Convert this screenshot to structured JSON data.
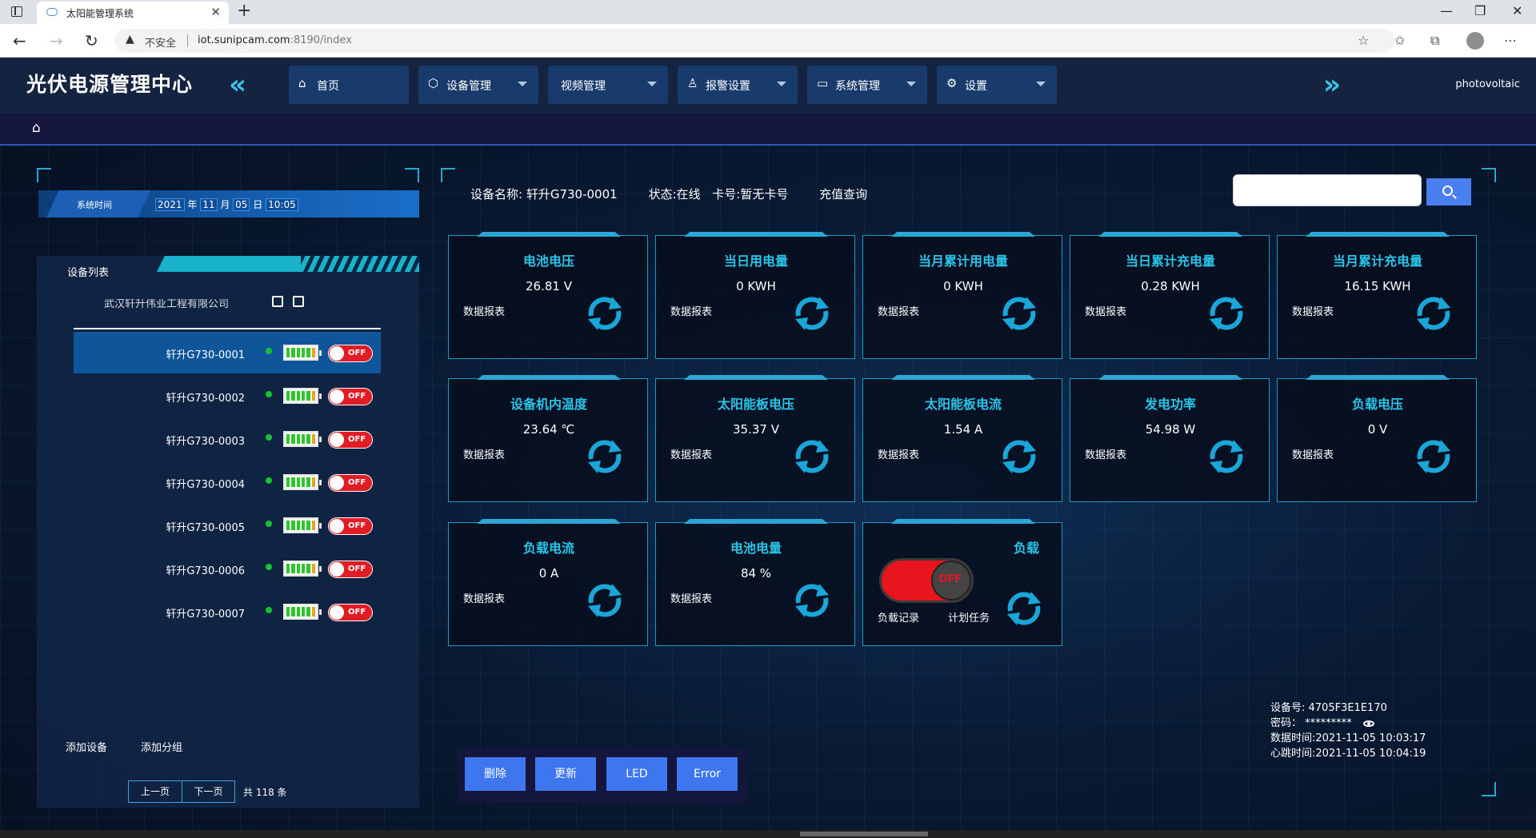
{
  "browser": {
    "tab_title": "太阳能管理系统",
    "tab_close": "✕",
    "new_tab": "+",
    "insecure_label": "不安全",
    "url_host": "iot.sunipcam.com",
    "url_path": ":8190/index"
  },
  "header": {
    "logo": "光伏电源管理中心",
    "collapse_arrow": "«",
    "expand_arrow": "»",
    "user": "photovoltaic",
    "nav": [
      {
        "label": "首页",
        "icon": "home-icon",
        "glyph": "⌂"
      },
      {
        "label": "设备管理",
        "icon": "cube-icon",
        "glyph": "⬡"
      },
      {
        "label": "视频管理",
        "icon": "",
        "glyph": ""
      },
      {
        "label": "报警设置",
        "icon": "user-icon",
        "glyph": "♙"
      },
      {
        "label": "系统管理",
        "icon": "monitor-icon",
        "glyph": "▭"
      },
      {
        "label": "设置",
        "icon": "gear-icon",
        "glyph": "⚙"
      }
    ]
  },
  "time": {
    "label": "系统时间",
    "year": "2021",
    "year_unit": "年",
    "month": "11",
    "month_unit": "月",
    "day": "05",
    "day_unit": "日",
    "clock": "10:05"
  },
  "device_list": {
    "title": "设备列表",
    "company": "武汉轩升伟业工程有限公司",
    "devices": [
      {
        "name": "轩升G730-0001",
        "switch": "OFF"
      },
      {
        "name": "轩升G730-0002",
        "switch": "OFF"
      },
      {
        "name": "轩升G730-0003",
        "switch": "OFF"
      },
      {
        "name": "轩升G730-0004",
        "switch": "OFF"
      },
      {
        "name": "轩升G730-0005",
        "switch": "OFF"
      },
      {
        "name": "轩升G730-0006",
        "switch": "OFF"
      },
      {
        "name": "轩升G730-0007",
        "switch": "OFF"
      }
    ],
    "add_device": "添加设备",
    "add_group": "添加分组",
    "prev": "上一页",
    "next": "下一页",
    "total": "共 118 条"
  },
  "info": {
    "device_name": "设备名称: 轩升G730-0001",
    "status": "状态:在线",
    "card": "卡号:暂无卡号",
    "recharge": "充值查询"
  },
  "cards": [
    {
      "title": "电池电压",
      "value": "26.81 V",
      "report": "数据报表"
    },
    {
      "title": "当日用电量",
      "value": "0 KWH",
      "report": "数据报表"
    },
    {
      "title": "当月累计用电量",
      "value": "0 KWH",
      "report": "数据报表"
    },
    {
      "title": "当日累计充电量",
      "value": "0.28 KWH",
      "report": "数据报表"
    },
    {
      "title": "当月累计充电量",
      "value": "16.15 KWH",
      "report": "数据报表"
    },
    {
      "title": "设备机内温度",
      "value": "23.64 ℃",
      "report": "数据报表"
    },
    {
      "title": "太阳能板电压",
      "value": "35.37 V",
      "report": "数据报表"
    },
    {
      "title": "太阳能板电流",
      "value": "1.54 A",
      "report": "数据报表"
    },
    {
      "title": "发电功率",
      "value": "54.98 W",
      "report": "数据报表"
    },
    {
      "title": "负载电压",
      "value": "0 V",
      "report": "数据报表"
    },
    {
      "title": "负载电流",
      "value": "0 A",
      "report": "数据报表"
    },
    {
      "title": "电池电量",
      "value": "84 %",
      "report": "数据报表"
    }
  ],
  "load_card": {
    "title": "负载",
    "switch": "OFF",
    "record": "负载记录",
    "task": "计划任务"
  },
  "device_info": {
    "id": "设备号: 4705F3E1E170",
    "password": "密码： *********",
    "data_time": "数据时间:2021-11-05 10:03:17",
    "heartbeat": "心跳时间:2021-11-05 10:04:19"
  },
  "actions": [
    "删除",
    "更新",
    "LED",
    "Error"
  ],
  "colors": {
    "accent": "#2bc4e8",
    "button": "#3e76f0",
    "off": "#e11c24",
    "online": "#15c230"
  }
}
